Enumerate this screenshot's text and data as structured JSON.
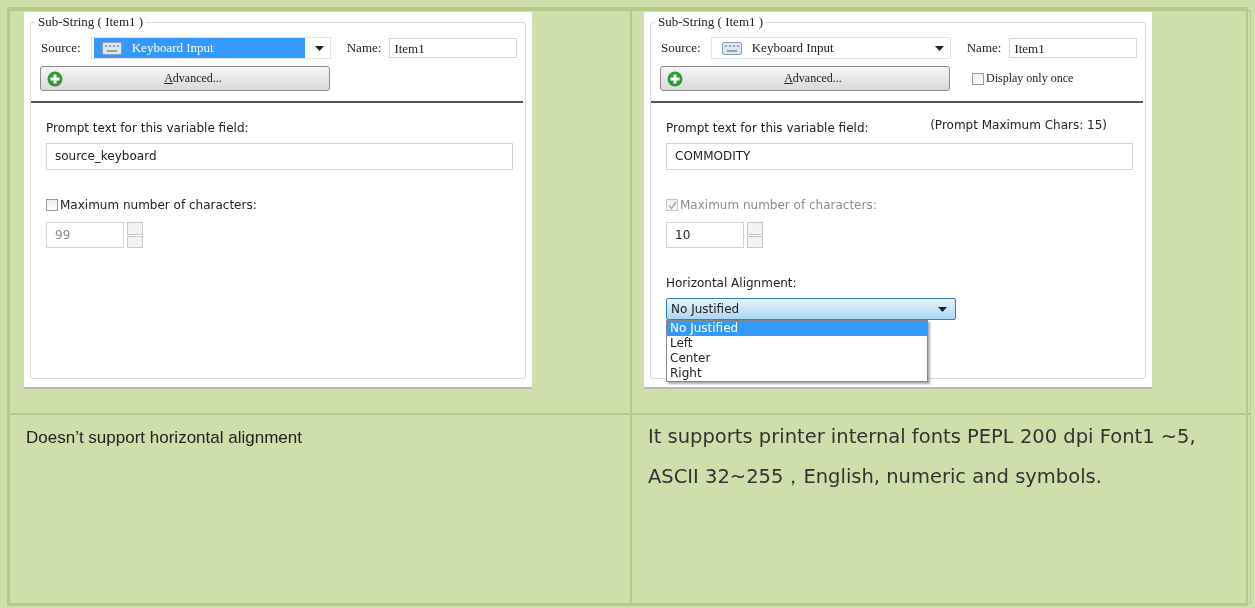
{
  "panels": [
    {
      "group_title": "Sub-String ( Item1 )",
      "source": {
        "label": "Source:",
        "value": "Keyboard Input",
        "focused": true
      },
      "name": {
        "label": "Name:",
        "value": "Item1"
      },
      "advanced_button": "Advanced...",
      "prompt": {
        "label": "Prompt text for this variable field:",
        "value": "source_keyboard"
      },
      "max_chars": {
        "label": "Maximum number of characters:",
        "checked": false,
        "disabled": false,
        "value": "99",
        "value_disabled": true
      }
    },
    {
      "group_title": "Sub-String ( Item1 )",
      "source": {
        "label": "Source:",
        "value": "Keyboard Input",
        "focused": false
      },
      "name": {
        "label": "Name:",
        "value": "Item1"
      },
      "advanced_button": "Advanced...",
      "display_once": {
        "label": "Display only once",
        "checked": false
      },
      "prompt": {
        "label": "Prompt text for this variable field:",
        "limit_note": "(Prompt Maximum Chars: 15)",
        "value": "COMMODITY"
      },
      "max_chars": {
        "label": "Maximum number of characters:",
        "checked": true,
        "disabled": true,
        "value": "10",
        "value_disabled": false
      },
      "alignment": {
        "label": "Horizontal Alignment:",
        "value": "No Justified",
        "expanded": true,
        "options": [
          {
            "label": "No Justified",
            "selected": true
          },
          {
            "label": "Left",
            "selected": false
          },
          {
            "label": "Center",
            "selected": false
          },
          {
            "label": "Right",
            "selected": false
          }
        ]
      }
    }
  ],
  "notes": [
    "Doesn’t support horizontal alignment",
    "It supports printer internal fonts PEPL 200 dpi Font1 ~5, ASCII 32~255，English, numeric and symbols."
  ]
}
